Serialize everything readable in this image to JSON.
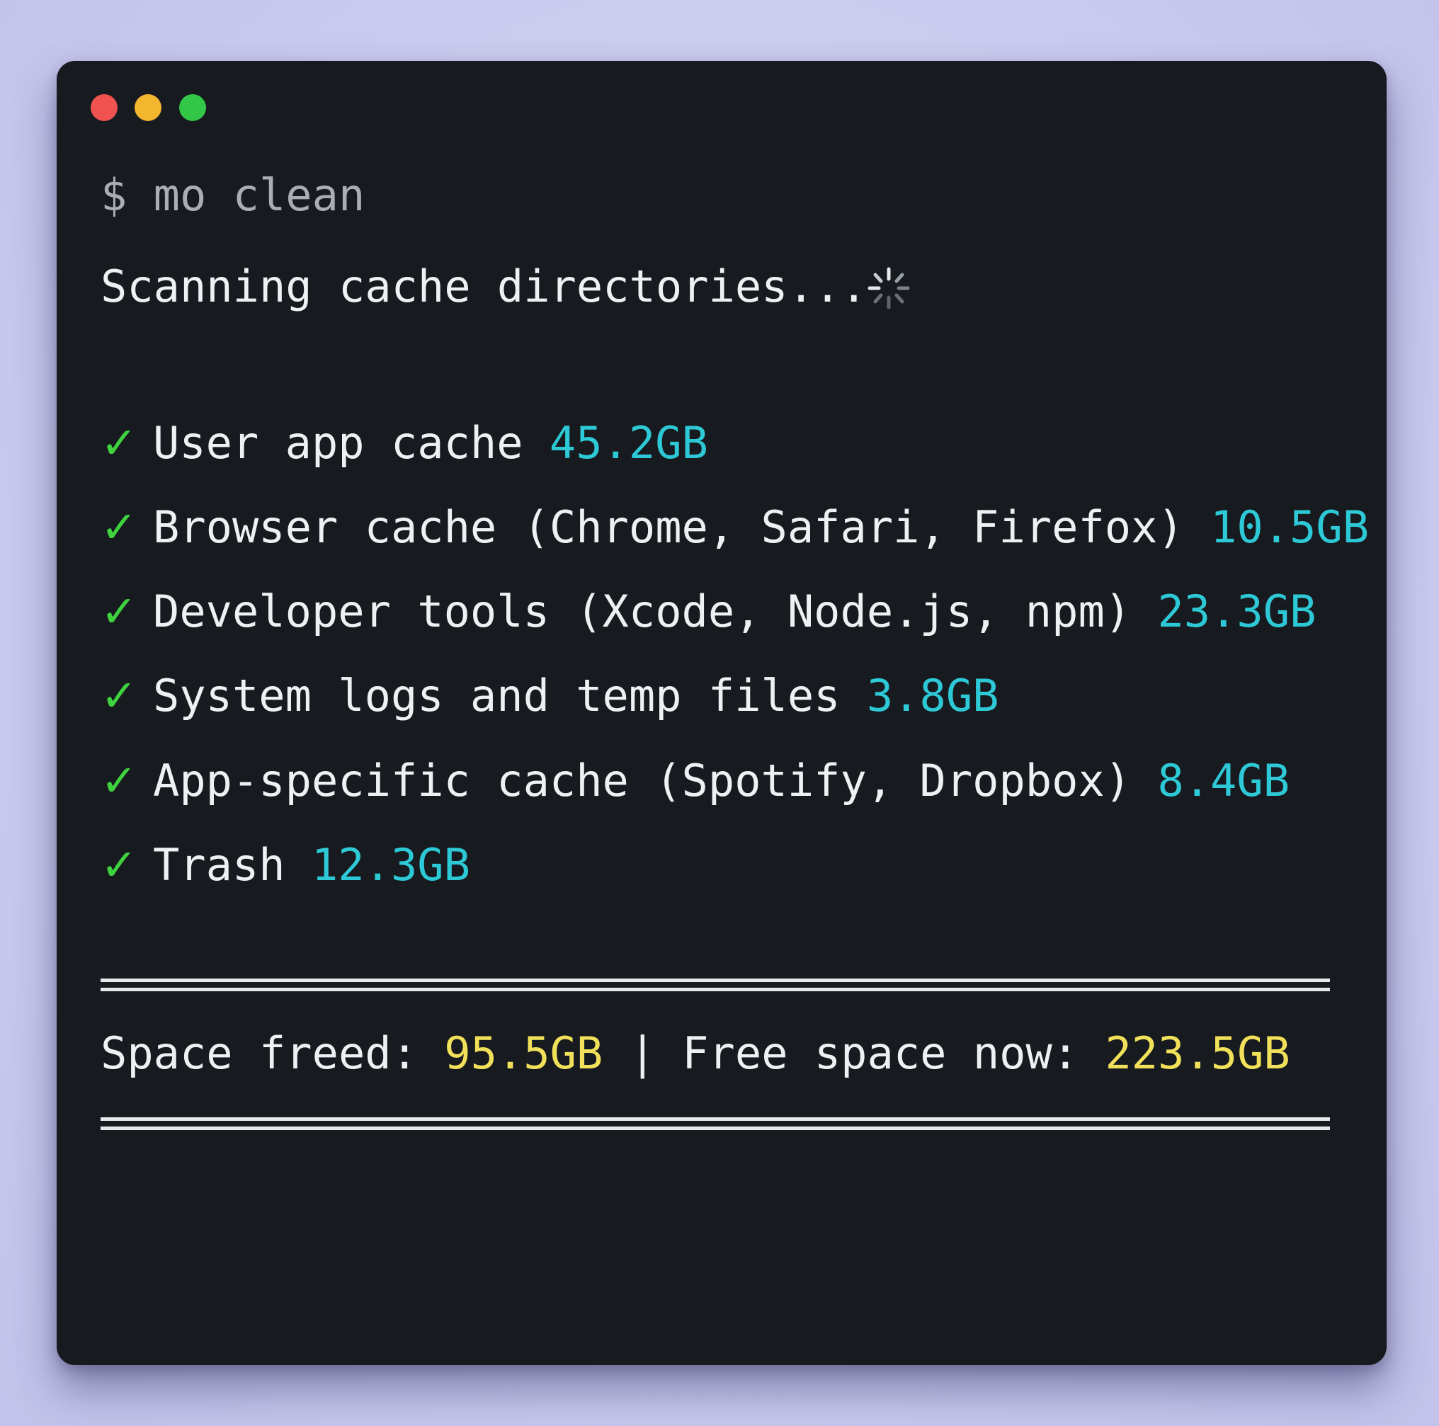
{
  "window": {
    "controls": [
      "close",
      "minimize",
      "zoom"
    ],
    "colors": {
      "close": "#f0524f",
      "minimize": "#f4b52f",
      "zoom": "#33c748"
    }
  },
  "command": {
    "prompt": "$",
    "text": "mo clean"
  },
  "status": {
    "text": "Scanning cache directories...",
    "spinner_icon": "loading-spinner-icon"
  },
  "results": [
    {
      "icon": "check-icon",
      "mark": "✓",
      "label": "User app cache",
      "size": "45.2GB"
    },
    {
      "icon": "check-icon",
      "mark": "✓",
      "label": "Browser cache (Chrome, Safari, Firefox)",
      "size": "10.5GB"
    },
    {
      "icon": "check-icon",
      "mark": "✓",
      "label": "Developer tools (Xcode, Node.js, npm)",
      "size": "23.3GB"
    },
    {
      "icon": "check-icon",
      "mark": "✓",
      "label": "System logs and temp files",
      "size": "3.8GB"
    },
    {
      "icon": "check-icon",
      "mark": "✓",
      "label": "App-specific cache (Spotify, Dropbox)",
      "size": "8.4GB"
    },
    {
      "icon": "check-icon",
      "mark": "✓",
      "label": "Trash",
      "size": "12.3GB"
    }
  ],
  "summary": {
    "freed_label": "Space freed:",
    "freed_value": "95.5GB",
    "divider": "|",
    "free_label": "Free space now:",
    "free_value": "223.5GB"
  },
  "colors": {
    "background": "#cdcdf0",
    "terminal_bg": "#171a1f",
    "text": "#eef0f3",
    "check": "#3fd23f",
    "size_accent": "#2ec9d6",
    "summary_accent": "#f1e15a"
  }
}
